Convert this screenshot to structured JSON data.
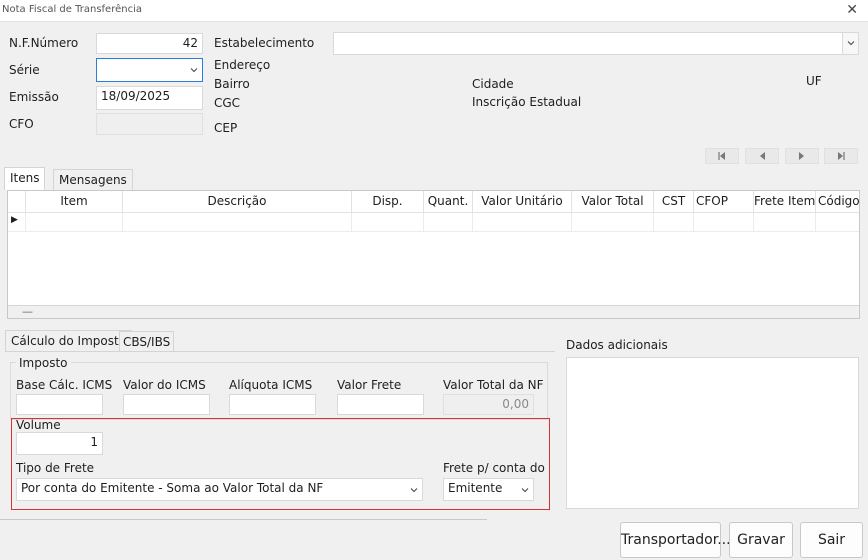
{
  "window": {
    "title": "Nota Fiscal de Transferência",
    "close_glyph": "✕"
  },
  "header": {
    "nf_numero_label": "N.F.Número",
    "nf_numero_value": "42",
    "serie_label": "Série",
    "serie_value": "",
    "emissao_label": "Emissão",
    "emissao_value": "18/09/2025",
    "cfo_label": "CFO",
    "cfo_value": "",
    "estabelecimento_label": "Estabelecimento",
    "estabelecimento_value": "",
    "endereco_label": "Endereço",
    "bairro_label": "Bairro",
    "cgc_label": "CGC",
    "cep_label": "CEP",
    "cidade_label": "Cidade",
    "inscricao_label": "Inscrição Estadual",
    "uf_label": "UF"
  },
  "nav_buttons": [
    "first-record",
    "previous-record",
    "next-record",
    "last-record"
  ],
  "item_tabs": [
    {
      "label": "Itens",
      "active": true
    },
    {
      "label": "Mensagens",
      "active": false
    }
  ],
  "items_grid": {
    "columns": [
      "Item",
      "Descrição",
      "Disp.",
      "Quant.",
      "Valor Unitário",
      "Valor Total",
      "CST",
      "CFOP",
      "Frete Item",
      "Código C"
    ],
    "row_indicator": "▶",
    "footer_handle": "—"
  },
  "calc_tabs": [
    {
      "label": "Cálculo do Imposto",
      "active": true
    },
    {
      "label": "CBS/IBS",
      "active": false
    }
  ],
  "imposto": {
    "group_label": "Imposto",
    "base_calc_label": "Base Cálc. ICMS",
    "base_calc_value": "",
    "valor_icms_label": "Valor do ICMS",
    "valor_icms_value": "",
    "aliquota_label": "Alíquota ICMS",
    "aliquota_value": "",
    "valor_frete_label": "Valor Frete",
    "valor_frete_value": "",
    "valor_total_label": "Valor Total da NF",
    "valor_total_value": "0,00"
  },
  "frete": {
    "volume_label": "Volume",
    "volume_value": "1",
    "tipo_label": "Tipo de Frete",
    "tipo_value": "Por conta do Emitente - Soma ao Valor Total da NF",
    "conta_label": "Frete p/ conta do",
    "conta_value": "Emitente"
  },
  "dados_adicionais": {
    "label": "Dados adicionais",
    "value": ""
  },
  "buttons": {
    "transportador": "Transportador...",
    "gravar": "Gravar",
    "sair": "Sair"
  },
  "colors": {
    "highlight_border": "#d9303a",
    "focus_border": "#2a7fd4"
  }
}
